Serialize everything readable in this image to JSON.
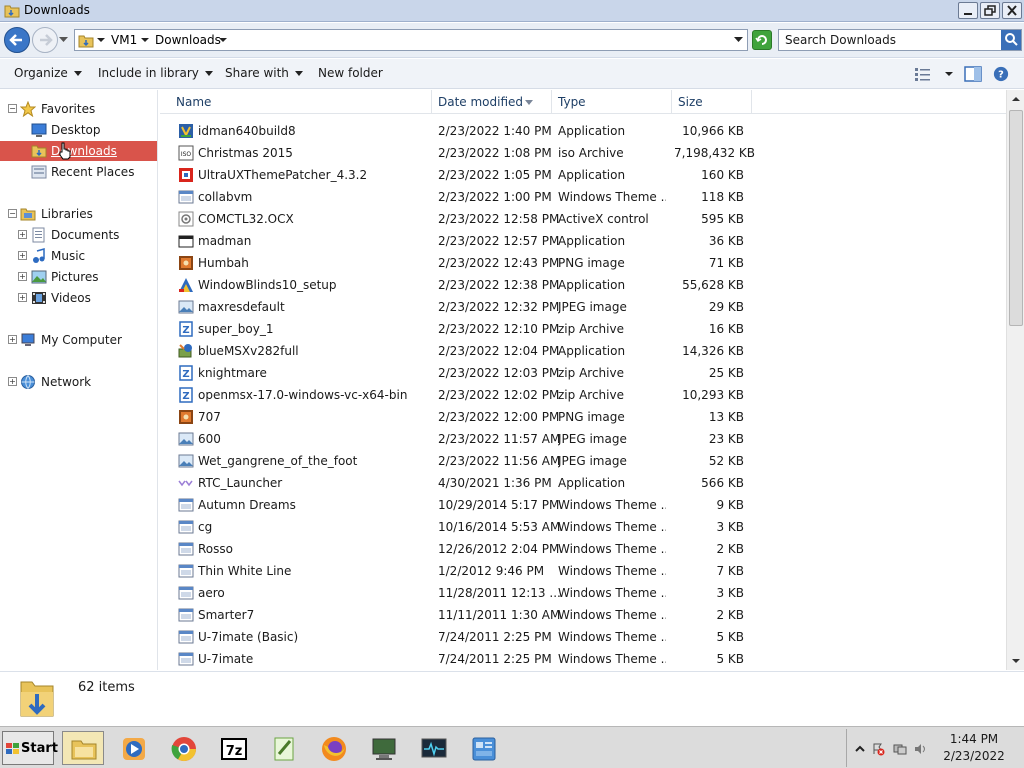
{
  "window": {
    "title": "Downloads"
  },
  "address": {
    "crumbs": [
      "VM1",
      "Downloads"
    ],
    "search_placeholder": "Search Downloads"
  },
  "toolbar": {
    "organize": "Organize",
    "include": "Include in library",
    "share": "Share with",
    "newfolder": "New folder"
  },
  "nav": {
    "favorites": "Favorites",
    "desktop": "Desktop",
    "downloads": "Downloads",
    "recent": "Recent Places",
    "libraries": "Libraries",
    "documents": "Documents",
    "music": "Music",
    "pictures": "Pictures",
    "videos": "Videos",
    "computer": "My Computer",
    "network": "Network"
  },
  "columns": {
    "name": "Name",
    "date": "Date modified",
    "type": "Type",
    "size": "Size"
  },
  "files": [
    {
      "name": "idman640build8",
      "date": "2/23/2022 1:40 PM",
      "type": "Application",
      "size": "10,966 KB",
      "icon": "idm-app-icon"
    },
    {
      "name": "Christmas 2015",
      "date": "2/23/2022 1:08 PM",
      "type": "iso Archive",
      "size": "7,198,432 KB",
      "icon": "iso-icon"
    },
    {
      "name": "UltraUXThemePatcher_4.3.2",
      "date": "2/23/2022 1:05 PM",
      "type": "Application",
      "size": "160 KB",
      "icon": "patcher-app-icon"
    },
    {
      "name": "collabvm",
      "date": "2/23/2022 1:00 PM",
      "type": "Windows Theme ...",
      "size": "118 KB",
      "icon": "theme-icon"
    },
    {
      "name": "COMCTL32.OCX",
      "date": "2/23/2022 12:58 PM",
      "type": "ActiveX control",
      "size": "595 KB",
      "icon": "activex-icon"
    },
    {
      "name": "madman",
      "date": "2/23/2022 12:57 PM",
      "type": "Application",
      "size": "36 KB",
      "icon": "window-app-icon"
    },
    {
      "name": "Humbah",
      "date": "2/23/2022 12:43 PM",
      "type": "PNG image",
      "size": "71 KB",
      "icon": "png-icon"
    },
    {
      "name": "WindowBlinds10_setup",
      "date": "2/23/2022 12:38 PM",
      "type": "Application",
      "size": "55,628 KB",
      "icon": "windowblinds-icon"
    },
    {
      "name": "maxresdefault",
      "date": "2/23/2022 12:32 PM",
      "type": "JPEG image",
      "size": "29 KB",
      "icon": "jpeg-icon"
    },
    {
      "name": "super_boy_1",
      "date": "2/23/2022 12:10 PM",
      "type": "zip Archive",
      "size": "16 KB",
      "icon": "zip-icon"
    },
    {
      "name": "blueMSXv282full",
      "date": "2/23/2022 12:04 PM",
      "type": "Application",
      "size": "14,326 KB",
      "icon": "installer-icon"
    },
    {
      "name": "knightmare",
      "date": "2/23/2022 12:03 PM",
      "type": "zip Archive",
      "size": "25 KB",
      "icon": "zip-icon"
    },
    {
      "name": "openmsx-17.0-windows-vc-x64-bin",
      "date": "2/23/2022 12:02 PM",
      "type": "zip Archive",
      "size": "10,293 KB",
      "icon": "zip-icon"
    },
    {
      "name": "707",
      "date": "2/23/2022 12:00 PM",
      "type": "PNG image",
      "size": "13 KB",
      "icon": "png-icon"
    },
    {
      "name": "600",
      "date": "2/23/2022 11:57 AM",
      "type": "JPEG image",
      "size": "23 KB",
      "icon": "jpeg-icon"
    },
    {
      "name": "Wet_gangrene_of_the_foot",
      "date": "2/23/2022 11:56 AM",
      "type": "JPEG image",
      "size": "52 KB",
      "icon": "jpeg-icon"
    },
    {
      "name": "RTC_Launcher",
      "date": "4/30/2021 1:36 PM",
      "type": "Application",
      "size": "566 KB",
      "icon": "rtc-app-icon"
    },
    {
      "name": "Autumn Dreams",
      "date": "10/29/2014 5:17 PM",
      "type": "Windows Theme ...",
      "size": "9 KB",
      "icon": "theme-icon"
    },
    {
      "name": "cg",
      "date": "10/16/2014 5:53 AM",
      "type": "Windows Theme ...",
      "size": "3 KB",
      "icon": "theme-icon"
    },
    {
      "name": "Rosso",
      "date": "12/26/2012 2:04 PM",
      "type": "Windows Theme ...",
      "size": "2 KB",
      "icon": "theme-icon"
    },
    {
      "name": "Thin White Line",
      "date": "1/2/2012 9:46 PM",
      "type": "Windows Theme ...",
      "size": "7 KB",
      "icon": "theme-icon"
    },
    {
      "name": "aero",
      "date": "11/28/2011 12:13 ...",
      "type": "Windows Theme ...",
      "size": "3 KB",
      "icon": "theme-icon"
    },
    {
      "name": "Smarter7",
      "date": "11/11/2011 1:30 AM",
      "type": "Windows Theme ...",
      "size": "2 KB",
      "icon": "theme-icon"
    },
    {
      "name": "U-7imate (Basic)",
      "date": "7/24/2011 2:25 PM",
      "type": "Windows Theme ...",
      "size": "5 KB",
      "icon": "theme-icon"
    },
    {
      "name": "U-7imate",
      "date": "7/24/2011 2:25 PM",
      "type": "Windows Theme ...",
      "size": "5 KB",
      "icon": "theme-icon"
    }
  ],
  "details": {
    "count": "62 items"
  },
  "taskbar": {
    "start": "Start",
    "apps": [
      "explorer-icon",
      "media-player-icon",
      "chrome-icon",
      "7zip-icon",
      "notepadpp-icon",
      "firefox-icon",
      "computer-icon",
      "task-monitor-icon",
      "control-panel-icon"
    ],
    "time": "1:44 PM",
    "date": "2/23/2022"
  },
  "colors": {
    "selected": "#d9544b",
    "link": "#1e3f66",
    "titlebar": "#c9d6ea"
  }
}
